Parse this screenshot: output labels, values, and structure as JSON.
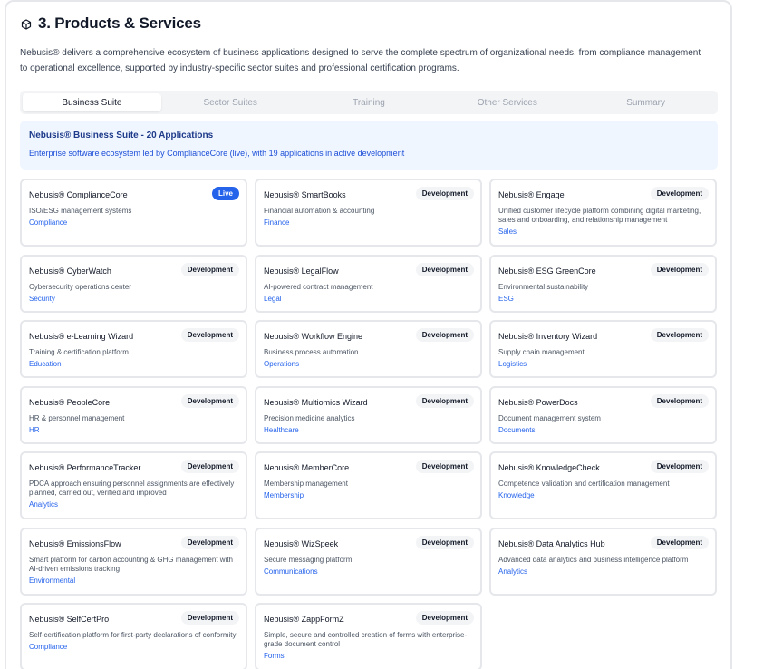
{
  "section": {
    "title": "3. Products & Services",
    "icon": "cube-icon",
    "intro": "Nebusis® delivers a comprehensive ecosystem of business applications designed to serve the complete spectrum of organizational needs, from compliance management to operational excellence, supported by industry-specific sector suites and professional certification programs."
  },
  "tabs": [
    {
      "label": "Business Suite",
      "active": true
    },
    {
      "label": "Sector Suites",
      "active": false
    },
    {
      "label": "Training",
      "active": false
    },
    {
      "label": "Other Services",
      "active": false
    },
    {
      "label": "Summary",
      "active": false
    }
  ],
  "banner": {
    "title": "Nebusis® Business Suite - 20 Applications",
    "subtitle": "Enterprise software ecosystem led by ComplianceCore (live), with 19 applications in active development"
  },
  "apps": [
    {
      "name": "Nebusis® ComplianceCore",
      "status": "Live",
      "desc": "ISO/ESG management systems",
      "category": "Compliance"
    },
    {
      "name": "Nebusis® SmartBooks",
      "status": "Development",
      "desc": "Financial automation & accounting",
      "category": "Finance"
    },
    {
      "name": "Nebusis® Engage",
      "status": "Development",
      "desc": "Unified customer lifecycle platform combining digital marketing, sales and onboarding, and relationship management",
      "category": "Sales"
    },
    {
      "name": "Nebusis® CyberWatch",
      "status": "Development",
      "desc": "Cybersecurity operations center",
      "category": "Security"
    },
    {
      "name": "Nebusis® LegalFlow",
      "status": "Development",
      "desc": "AI-powered contract management",
      "category": "Legal"
    },
    {
      "name": "Nebusis® ESG GreenCore",
      "status": "Development",
      "desc": "Environmental sustainability",
      "category": "ESG"
    },
    {
      "name": "Nebusis® e-Learning Wizard",
      "status": "Development",
      "desc": "Training & certification platform",
      "category": "Education"
    },
    {
      "name": "Nebusis® Workflow Engine",
      "status": "Development",
      "desc": "Business process automation",
      "category": "Operations"
    },
    {
      "name": "Nebusis® Inventory Wizard",
      "status": "Development",
      "desc": "Supply chain management",
      "category": "Logistics"
    },
    {
      "name": "Nebusis® PeopleCore",
      "status": "Development",
      "desc": "HR & personnel management",
      "category": "HR"
    },
    {
      "name": "Nebusis® Multiomics Wizard",
      "status": "Development",
      "desc": "Precision medicine analytics",
      "category": "Healthcare"
    },
    {
      "name": "Nebusis® PowerDocs",
      "status": "Development",
      "desc": "Document management system",
      "category": "Documents"
    },
    {
      "name": "Nebusis® PerformanceTracker",
      "status": "Development",
      "desc": "PDCA approach ensuring personnel assignments are effectively planned, carried out, verified and improved",
      "category": "Analytics"
    },
    {
      "name": "Nebusis® MemberCore",
      "status": "Development",
      "desc": "Membership management",
      "category": "Membership"
    },
    {
      "name": "Nebusis® KnowledgeCheck",
      "status": "Development",
      "desc": "Competence validation and certification management",
      "category": "Knowledge"
    },
    {
      "name": "Nebusis® EmissionsFlow",
      "status": "Development",
      "desc": "Smart platform for carbon accounting & GHG management with AI-driven emissions tracking",
      "category": "Environmental"
    },
    {
      "name": "Nebusis® WizSpeek",
      "status": "Development",
      "desc": "Secure messaging platform",
      "category": "Communications"
    },
    {
      "name": "Nebusis® Data Analytics Hub",
      "status": "Development",
      "desc": "Advanced data analytics and business intelligence platform",
      "category": "Analytics"
    },
    {
      "name": "Nebusis® SelfCertPro",
      "status": "Development",
      "desc": "Self-certification platform for first-party declarations of conformity",
      "category": "Compliance"
    },
    {
      "name": "Nebusis® ZappFormZ",
      "status": "Development",
      "desc": "Simple, secure and controlled creation of forms with enterprise-grade document control",
      "category": "Forms"
    }
  ],
  "colors": {
    "accent": "#2563eb",
    "banner_bg": "#eff6ff",
    "banner_title": "#1e3a8a",
    "badge_bg": "#f3f4f6"
  }
}
